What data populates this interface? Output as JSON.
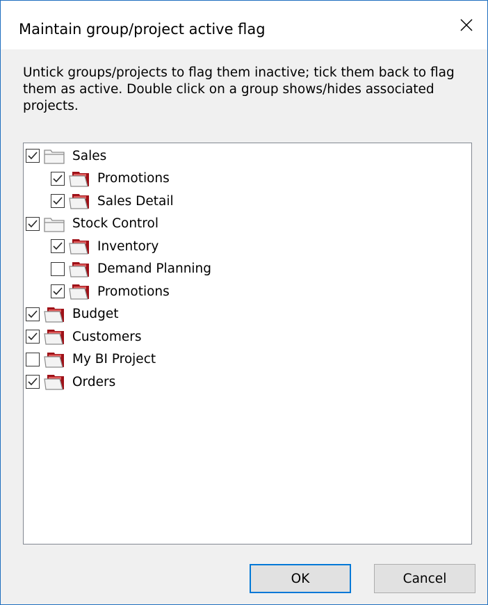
{
  "dialog": {
    "title": "Maintain group/project active flag",
    "description": "Untick groups/projects to flag them inactive; tick them back to flag them as active. Double click on a group shows/hides associated projects."
  },
  "tree": {
    "items": [
      {
        "label": "Sales",
        "type": "group",
        "level": 0,
        "checked": true
      },
      {
        "label": "Promotions",
        "type": "project",
        "level": 1,
        "checked": true
      },
      {
        "label": "Sales Detail",
        "type": "project",
        "level": 1,
        "checked": true
      },
      {
        "label": "Stock Control",
        "type": "group",
        "level": 0,
        "checked": true
      },
      {
        "label": "Inventory",
        "type": "project",
        "level": 1,
        "checked": true
      },
      {
        "label": "Demand Planning",
        "type": "project",
        "level": 1,
        "checked": false
      },
      {
        "label": "Promotions",
        "type": "project",
        "level": 1,
        "checked": true
      },
      {
        "label": "Budget",
        "type": "project",
        "level": 0,
        "checked": true
      },
      {
        "label": "Customers",
        "type": "project",
        "level": 0,
        "checked": true
      },
      {
        "label": "My BI Project",
        "type": "project",
        "level": 0,
        "checked": false
      },
      {
        "label": "Orders",
        "type": "project",
        "level": 0,
        "checked": true
      }
    ]
  },
  "buttons": {
    "ok_label": "OK",
    "cancel_label": "Cancel"
  },
  "colors": {
    "accent": "#0078d7",
    "project_folder": "#b5121b",
    "group_folder": "#8c8c8c"
  }
}
